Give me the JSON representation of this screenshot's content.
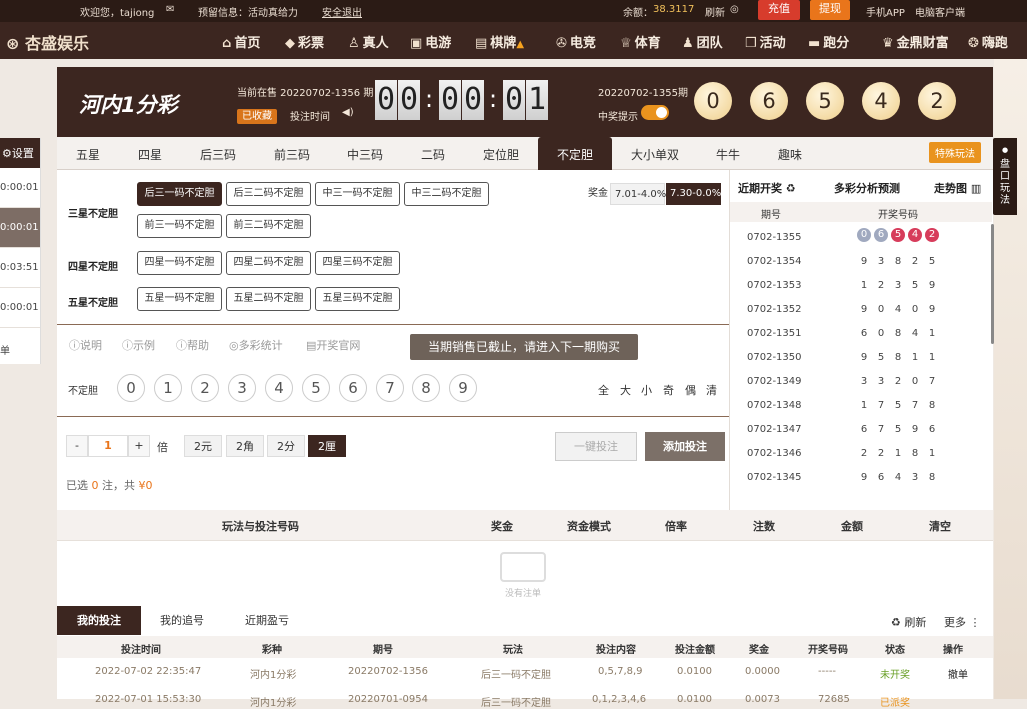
{
  "topbar": {
    "welcome": "欢迎您，tajiong",
    "notice_label": "预留信息：活动真给力",
    "logout": "安全退出",
    "balance_label": "余额：",
    "balance": "38.3117",
    "refresh": "刷新",
    "deposit": "充值",
    "withdraw": "提现",
    "app": "手机APP",
    "client": "电脑客户端"
  },
  "nav": {
    "logo": "杏盛娱乐",
    "items": [
      {
        "label": "首页",
        "icon": "⌂"
      },
      {
        "label": "彩票",
        "icon": "◆"
      },
      {
        "label": "真人",
        "icon": "♙"
      },
      {
        "label": "电游",
        "icon": "▣"
      },
      {
        "label": "棋牌",
        "icon": "▤"
      },
      {
        "label": "电竞",
        "icon": "✇"
      },
      {
        "label": "体育",
        "icon": "♕"
      },
      {
        "label": "团队",
        "icon": "♟"
      },
      {
        "label": "活动",
        "icon": "❒"
      },
      {
        "label": "跑分",
        "icon": "▬"
      },
      {
        "label": "金鼎财富",
        "icon": "♛"
      },
      {
        "label": "嗨跑",
        "icon": "❂"
      }
    ]
  },
  "left_panel": {
    "settings": "设置",
    "rows": [
      "0:00:01",
      "0:00:01",
      "0:03:51",
      "0:00:01",
      "单"
    ]
  },
  "header": {
    "logo": "河内1分彩",
    "current_label": "当前在售 20220702-1356 期",
    "fav": "已收藏",
    "bet_time_label": "投注时间",
    "countdown": [
      "0",
      "0",
      "0",
      "0",
      "0",
      "1"
    ],
    "last_issue": "20220702-1355期",
    "win_notice": "中奖提示",
    "balls": [
      "0",
      "6",
      "5",
      "4",
      "2"
    ]
  },
  "tabs": [
    "五星",
    "四星",
    "后三码",
    "前三码",
    "中三码",
    "二码",
    "定位胆",
    "不定胆",
    "大小单双",
    "牛牛",
    "趣味"
  ],
  "special": "特殊玩法",
  "groups": [
    {
      "label": "三星不定胆",
      "options": [
        "后三一码不定胆",
        "后三二码不定胆",
        "中三一码不定胆",
        "中三二码不定胆",
        "前三一码不定胆",
        "前三二码不定胆"
      ]
    },
    {
      "label": "四星不定胆",
      "options": [
        "四星一码不定胆",
        "四星二码不定胆",
        "四星三码不定胆"
      ]
    },
    {
      "label": "五星不定胆",
      "options": [
        "五星一码不定胆",
        "五星二码不定胆",
        "五星三码不定胆"
      ]
    }
  ],
  "bonus": {
    "label": "奖金",
    "opt1": "7.01-4.0%",
    "opt2": "7.30-0.0%"
  },
  "tools": [
    "说明",
    "示例",
    "帮助",
    "多彩统计",
    "开奖官网"
  ],
  "notice": "当期销售已截止，请进入下一期购买",
  "pick": {
    "label": "不定胆",
    "numbers": [
      "0",
      "1",
      "2",
      "3",
      "4",
      "5",
      "6",
      "7",
      "8",
      "9"
    ],
    "quick": [
      "全",
      "大",
      "小",
      "奇",
      "偶",
      "清"
    ]
  },
  "multiplier": {
    "minus": "-",
    "value": "1",
    "plus": "+",
    "label": "倍",
    "units": [
      "2元",
      "2角",
      "2分",
      "2厘"
    ]
  },
  "actions": {
    "quick_bet": "一键投注",
    "add_bet": "添加投注"
  },
  "summary": {
    "prefix": "已选",
    "count": "0",
    "mid": "注，共",
    "amount": "¥0"
  },
  "side": {
    "recent": "近期开奖",
    "analysis": "多彩分析预测",
    "trend": "走势图",
    "col1": "期号",
    "col2": "开奖号码",
    "rows": [
      {
        "issue": "0702-1355",
        "nums": [
          "0",
          "6",
          "5",
          "4",
          "2"
        ]
      },
      {
        "issue": "0702-1354",
        "nums": [
          "9",
          "3",
          "8",
          "2",
          "5"
        ]
      },
      {
        "issue": "0702-1353",
        "nums": [
          "1",
          "2",
          "3",
          "5",
          "9"
        ]
      },
      {
        "issue": "0702-1352",
        "nums": [
          "9",
          "0",
          "4",
          "0",
          "9"
        ]
      },
      {
        "issue": "0702-1351",
        "nums": [
          "6",
          "0",
          "8",
          "4",
          "1"
        ]
      },
      {
        "issue": "0702-1350",
        "nums": [
          "9",
          "5",
          "8",
          "1",
          "1"
        ]
      },
      {
        "issue": "0702-1349",
        "nums": [
          "3",
          "3",
          "2",
          "0",
          "7"
        ]
      },
      {
        "issue": "0702-1348",
        "nums": [
          "1",
          "7",
          "5",
          "7",
          "8"
        ]
      },
      {
        "issue": "0702-1347",
        "nums": [
          "6",
          "7",
          "5",
          "9",
          "6"
        ]
      },
      {
        "issue": "0702-1346",
        "nums": [
          "2",
          "2",
          "1",
          "8",
          "1"
        ]
      },
      {
        "issue": "0702-1345",
        "nums": [
          "9",
          "6",
          "4",
          "3",
          "8"
        ]
      }
    ]
  },
  "bet_table": {
    "headers": [
      "玩法与投注号码",
      "奖金",
      "资金模式",
      "倍率",
      "注数",
      "金额",
      "清空"
    ],
    "empty": "没有注单"
  },
  "bottom": {
    "tabs": [
      "我的投注",
      "我的追号",
      "近期盈亏"
    ],
    "refresh": "刷新",
    "more": "更多",
    "headers": [
      "投注时间",
      "彩种",
      "期号",
      "玩法",
      "投注内容",
      "投注金额",
      "奖金",
      "开奖号码",
      "状态",
      "操作"
    ],
    "row": [
      "2022-07-02 22:35:47",
      "河内1分彩",
      "20220702-1356",
      "后三一码不定胆",
      "0,5,7,8,9",
      "0.0100",
      "0.0000",
      "-----",
      "未开奖",
      "撤单"
    ],
    "row2": [
      "2022-07-01 15:53:30",
      "河内1分彩",
      "20220701-0954",
      "后三一码不定胆",
      "0,1,2,3,4,6",
      "0.0100",
      "0.0073",
      "72685",
      "已派奖"
    ]
  },
  "sidetab": "盘口玩法",
  "colors": {
    "brown": "#3c2620",
    "orange": "#e9931e",
    "red": "#d73c5b",
    "grey_ball": "#a0a9bf"
  }
}
